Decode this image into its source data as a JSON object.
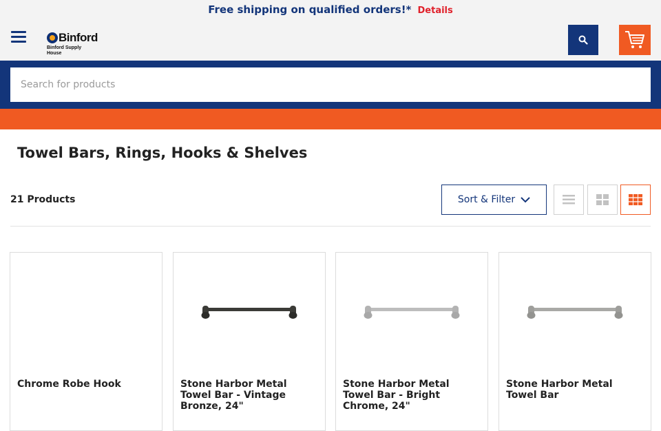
{
  "promo": {
    "message": "Free shipping on qualified orders!*",
    "details_label": "Details"
  },
  "header": {
    "logo_name": "Binford",
    "logo_subtitle": "Binford Supply House",
    "menu_icon": "hamburger-menu-icon",
    "search_icon": "search-icon",
    "cart_icon": "shopping-cart-icon"
  },
  "search": {
    "placeholder": "Search for products",
    "value": ""
  },
  "page": {
    "title": "Towel Bars, Rings, Hooks & Shelves",
    "product_count": "21 Products"
  },
  "toolbar": {
    "sort_label": "Sort & Filter",
    "views": [
      "list-view-icon",
      "large-grid-view-icon",
      "small-grid-view-icon"
    ],
    "active_view": "small-grid-view-icon"
  },
  "products": [
    {
      "name": "Chrome Robe Hook",
      "finish": "none"
    },
    {
      "name": "Stone Harbor Metal Towel Bar - Vintage Bronze, 24\"",
      "finish": "bronze"
    },
    {
      "name": "Stone Harbor Metal Towel Bar - Bright Chrome, 24\"",
      "finish": "chrome"
    },
    {
      "name": "Stone Harbor Metal Towel Bar",
      "finish": "nickel"
    }
  ],
  "colors": {
    "navy": "#13357a",
    "orange": "#f05a22",
    "red": "#e0212b",
    "bronze": "#3b3b37",
    "chrome": "#bdbdbd",
    "nickel": "#a9a9a6"
  }
}
